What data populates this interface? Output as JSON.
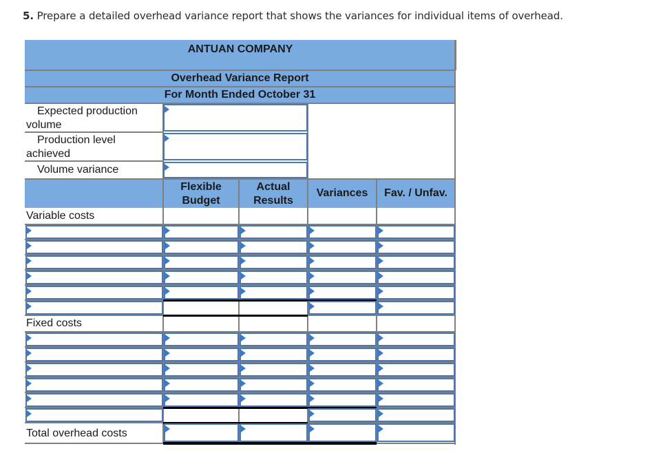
{
  "prompt": {
    "number": "5.",
    "text": " Prepare a detailed overhead variance report that shows the variances for individual items of overhead."
  },
  "report": {
    "company": "ANTUAN COMPANY",
    "title": "Overhead Variance Report",
    "period": "For Month Ended October 31",
    "volume_section": {
      "expected_production_volume_label": "Expected production volume",
      "production_level_achieved_label": "Production level achieved",
      "volume_variance_label": "Volume variance",
      "expected_production_volume_value": "",
      "production_level_achieved_value": "",
      "volume_variance_value": ""
    },
    "columns": {
      "flexible_budget": "Flexible Budget",
      "actual_results": "Actual Results",
      "variances": "Variances",
      "fav_unfav": "Fav. / Unfav."
    },
    "variable_costs": {
      "label": "Variable costs",
      "rows": [
        {
          "item": "",
          "flexible_budget": "",
          "actual_results": "",
          "variance": "",
          "fav_unfav": ""
        },
        {
          "item": "",
          "flexible_budget": "",
          "actual_results": "",
          "variance": "",
          "fav_unfav": ""
        },
        {
          "item": "",
          "flexible_budget": "",
          "actual_results": "",
          "variance": "",
          "fav_unfav": ""
        },
        {
          "item": "",
          "flexible_budget": "",
          "actual_results": "",
          "variance": "",
          "fav_unfav": ""
        },
        {
          "item": "",
          "flexible_budget": "",
          "actual_results": "",
          "variance": "",
          "fav_unfav": ""
        }
      ],
      "total_row": {
        "item": "",
        "variance": "",
        "fav_unfav": ""
      }
    },
    "fixed_costs": {
      "label": "Fixed costs",
      "rows": [
        {
          "item": "",
          "flexible_budget": "",
          "actual_results": "",
          "variance": "",
          "fav_unfav": ""
        },
        {
          "item": "",
          "flexible_budget": "",
          "actual_results": "",
          "variance": "",
          "fav_unfav": ""
        },
        {
          "item": "",
          "flexible_budget": "",
          "actual_results": "",
          "variance": "",
          "fav_unfav": ""
        },
        {
          "item": "",
          "flexible_budget": "",
          "actual_results": "",
          "variance": "",
          "fav_unfav": ""
        },
        {
          "item": "",
          "flexible_budget": "",
          "actual_results": "",
          "variance": "",
          "fav_unfav": ""
        }
      ],
      "total_row": {
        "item": "",
        "variance": "",
        "fav_unfav": ""
      }
    },
    "total_overhead": {
      "label": "Total overhead costs",
      "flexible_budget": "",
      "actual_results": "",
      "variance": "",
      "fav_unfav": ""
    }
  }
}
